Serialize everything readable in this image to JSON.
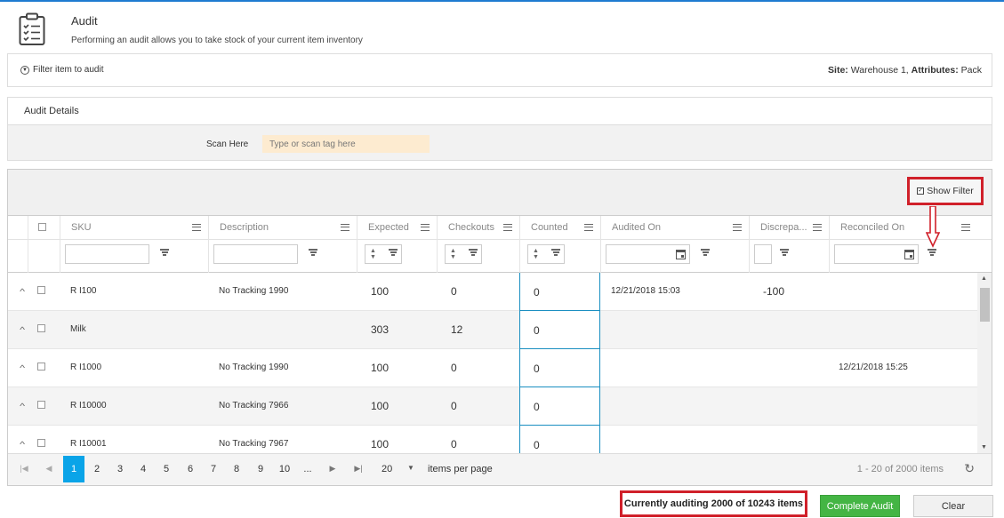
{
  "header": {
    "title": "Audit",
    "subtitle": "Performing an audit allows you to take stock of your current item inventory",
    "icon": "clipboard-icon"
  },
  "filter_bar": {
    "toggle_label": "Filter item to audit",
    "site_label": "Site:",
    "site_value": " Warehouse 1, ",
    "attributes_label": "Attributes:",
    "attributes_value": " Pack"
  },
  "audit_details": {
    "title": "Audit Details",
    "scan_label": "Scan Here",
    "scan_placeholder": "Type or scan tag here"
  },
  "grid": {
    "show_filter_label": "Show Filter",
    "columns": [
      "SKU",
      "Description",
      "Expected",
      "Checkouts",
      "Counted",
      "Audited On",
      "Discrepa...",
      "Reconciled On"
    ],
    "rows": [
      {
        "sku": "R I100",
        "description": "No Tracking 1990",
        "expected": "100",
        "checkouts": "0",
        "counted": "0",
        "audited_on": "12/21/2018 15:03",
        "discrepancy": "-100",
        "reconciled_on": ""
      },
      {
        "sku": "Milk",
        "description": "",
        "expected": "303",
        "checkouts": "12",
        "counted": "0",
        "audited_on": "",
        "discrepancy": "",
        "reconciled_on": ""
      },
      {
        "sku": "R I1000",
        "description": "No Tracking 1990",
        "expected": "100",
        "checkouts": "0",
        "counted": "0",
        "audited_on": "",
        "discrepancy": "",
        "reconciled_on": "12/21/2018 15:25"
      },
      {
        "sku": "R I10000",
        "description": "No Tracking 7966",
        "expected": "100",
        "checkouts": "0",
        "counted": "0",
        "audited_on": "",
        "discrepancy": "",
        "reconciled_on": ""
      },
      {
        "sku": "R I10001",
        "description": "No Tracking 7967",
        "expected": "100",
        "checkouts": "0",
        "counted": "0",
        "audited_on": "",
        "discrepancy": "",
        "reconciled_on": ""
      }
    ]
  },
  "pager": {
    "pages": [
      "1",
      "2",
      "3",
      "4",
      "5",
      "6",
      "7",
      "8",
      "9",
      "10",
      "..."
    ],
    "active_page": "1",
    "per_page": "20",
    "per_page_label": "items per page",
    "range": "1 - 20 of 2000 items"
  },
  "footer": {
    "status": "Currently auditing 2000 of 10243 items",
    "complete_label": "Complete Audit",
    "clear_label": "Clear"
  },
  "colors": {
    "accent": "#0aa4e8",
    "highlight": "#d0202a",
    "complete": "#44b544",
    "scan_bg": "#fdebd0",
    "top_border": "#1e7bd1"
  }
}
